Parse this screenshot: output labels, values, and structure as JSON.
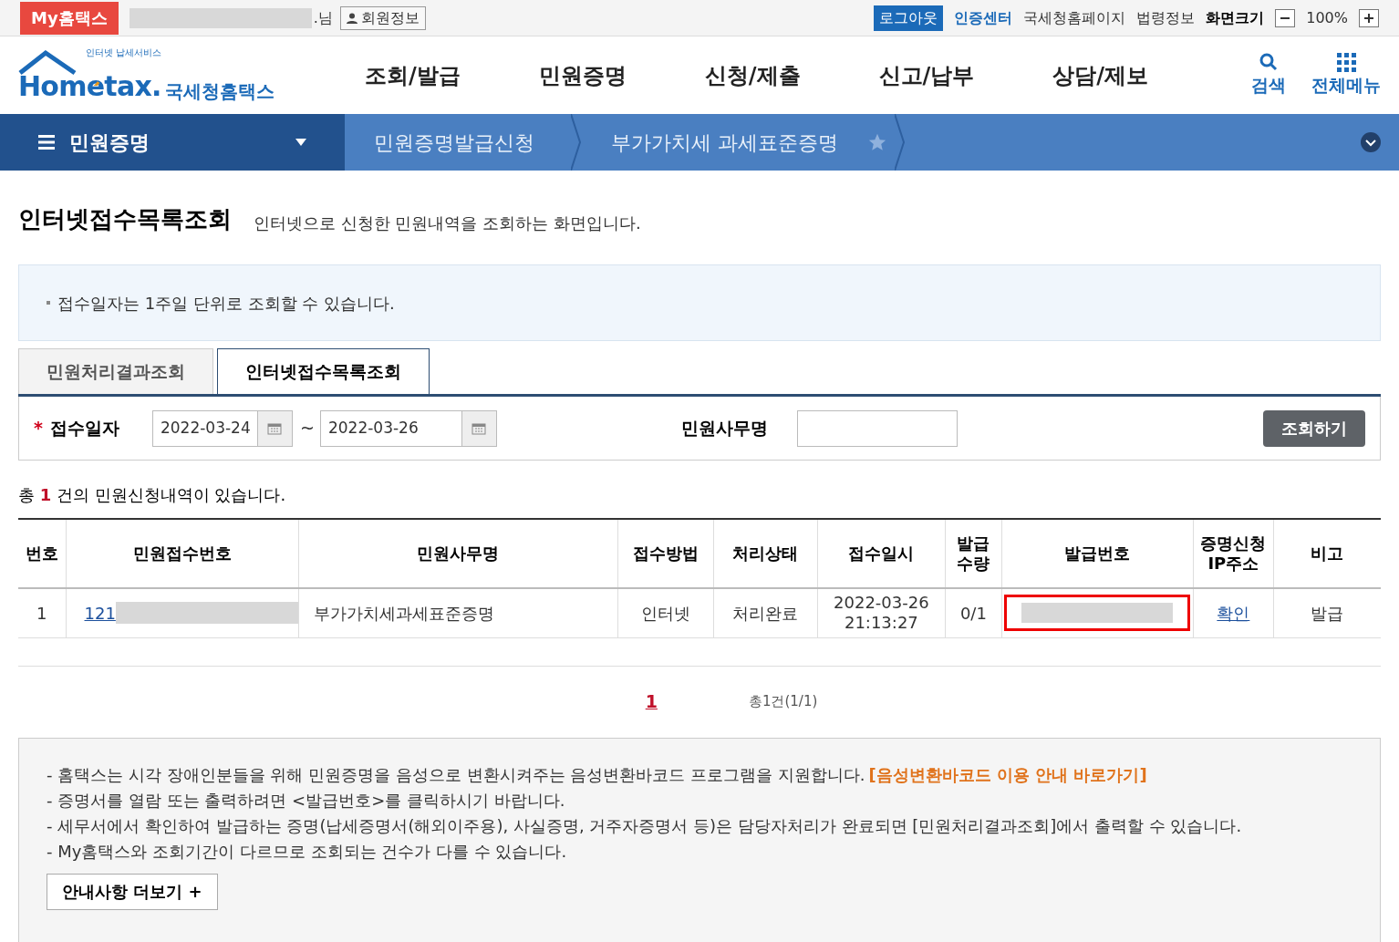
{
  "top_bar": {
    "my_hometax": "My홈택스",
    "user_suffix": ".님",
    "member_info": "회원정보",
    "links": [
      {
        "label": "로그아웃",
        "kind": "button"
      },
      {
        "label": "인증센터",
        "kind": "accent"
      },
      {
        "label": "국세청홈페이지",
        "kind": "plain"
      },
      {
        "label": "법령정보",
        "kind": "plain"
      },
      {
        "label": "화면크기",
        "kind": "bold"
      }
    ],
    "zoom": "100%"
  },
  "header": {
    "logo_small": "인터넷 납세서비스",
    "logo_main": "Hometax.",
    "logo_sub": "국세청홈택스",
    "menu": [
      "조회/발급",
      "민원증명",
      "신청/제출",
      "신고/납부",
      "상담/제보"
    ],
    "search": "검색",
    "all_menu": "전체메뉴"
  },
  "breadcrumb": {
    "menu": "민원증명",
    "items": [
      {
        "label": "민원증명발급신청",
        "favorite": false
      },
      {
        "label": "부가가치세 과세표준증명",
        "favorite": true
      }
    ]
  },
  "page": {
    "title": "인터넷접수목록조회",
    "description": "인터넷으로 신청한 민원내역을 조회하는 화면입니다.",
    "info": "접수일자는 1주일 단위로 조회할 수 있습니다."
  },
  "tabs": [
    {
      "label": "민원처리결과조회",
      "selected": false
    },
    {
      "label": "인터넷접수목록조회",
      "selected": true
    }
  ],
  "search_form": {
    "required_mark": "*",
    "date_label": "접수일자",
    "date_from": "2022-03-24",
    "date_sep": "~",
    "date_to": "2022-03-26",
    "name_label": "민원사무명",
    "search_button": "조회하기"
  },
  "summary": {
    "prefix": "총",
    "count": "1",
    "suffix": "건의 민원신청내역이 있습니다."
  },
  "table": {
    "columns": [
      "번호",
      "민원접수번호",
      "민원사무명",
      "접수방법",
      "처리상태",
      "접수일시",
      "발급\n수량",
      "발급번호",
      "증명신청\nIP주소",
      "비고"
    ],
    "rows": [
      {
        "no": "1",
        "receipt_no": "121",
        "name": "부가가치세과세표준증명",
        "method": "인터넷",
        "status": "처리완료",
        "date": "2022-03-26",
        "time": "21:13:27",
        "qty": "0/1",
        "ip": "확인",
        "note": "발급"
      }
    ]
  },
  "pagination": {
    "pages": [
      {
        "label": "1",
        "selected": true
      }
    ],
    "total": "총1건(1/1)"
  },
  "notices": [
    "- 홈택스는 시각 장애인분들을 위해 민원증명을 음성으로 변환시켜주는 음성변환바코드 프로그램을 지원합니다.",
    "- 증명서를 열람 또는 출력하려면 <발급번호>를 클릭하시기 바랍니다.",
    "- 세무서에서 확인하여 발급하는 증명(납세증명서(해외이주용), 사실증명, 거주자증명서 등)은 담당자처리가 완료되면 [민원처리결과조회]에서 출력할 수 있습니다.",
    "- My홈택스와 조회기간이 다르므로 조회되는 건수가 다를 수 있습니다."
  ],
  "notice_link": "[음성변환바코드 이용 안내 바로가기]",
  "more_button": "안내사항 더보기 +"
}
